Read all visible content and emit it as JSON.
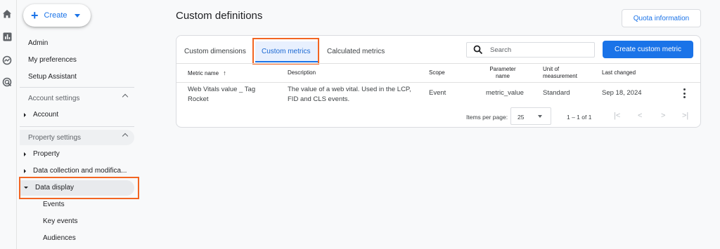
{
  "rail": {
    "icons": [
      "home-icon",
      "reports-icon",
      "explore-icon",
      "advertising-icon"
    ]
  },
  "sidebar": {
    "create_label": "Create",
    "links": [
      "Admin",
      "My preferences",
      "Setup Assistant"
    ],
    "account_settings_label": "Account settings",
    "account_item": "Account",
    "property_settings_label": "Property settings",
    "property_item": "Property",
    "data_collection_item": "Data collection and modifica...",
    "data_display_item": "Data display",
    "sub_items": [
      "Events",
      "Key events",
      "Audiences"
    ]
  },
  "main": {
    "title": "Custom definitions",
    "quota_button": "Quota information",
    "tabs": [
      "Custom dimensions",
      "Custom metrics",
      "Calculated metrics"
    ],
    "search_placeholder": "Search",
    "create_button": "Create custom metric",
    "table": {
      "headers": {
        "metric_name": "Metric name",
        "sort_icon": "↑",
        "description": "Description",
        "scope": "Scope",
        "parameter_name_1": "Parameter",
        "parameter_name_2": "name",
        "unit_1": "Unit of",
        "unit_2": "measurement",
        "last_changed": "Last changed"
      },
      "rows": [
        {
          "metric_name_1": "Web Vitals value _ Tag",
          "metric_name_2": "Rocket",
          "description_1": "The value of a web vital. Used in the LCP,",
          "description_2": "FID and CLS events.",
          "scope": "Event",
          "parameter_name": "metric_value",
          "unit": "Standard",
          "last_changed": "Sep 18, 2024"
        }
      ]
    },
    "pagination": {
      "items_label": "Items per page:",
      "items_value": "25",
      "range": "1 – 1 of 1",
      "first": "|<",
      "prev": "<",
      "next": ">",
      "last": ">|"
    }
  },
  "colors": {
    "accent": "#1a73e8",
    "highlight": "#f26522"
  }
}
